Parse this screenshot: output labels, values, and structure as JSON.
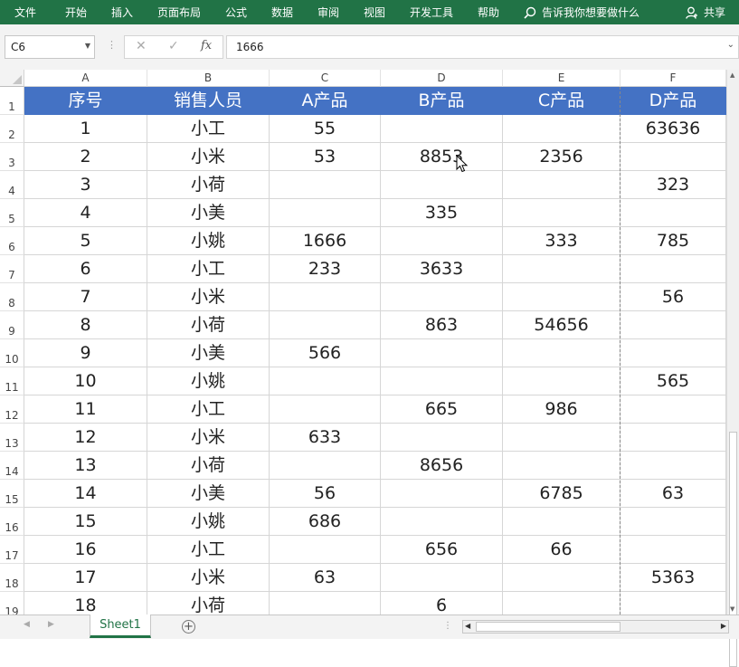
{
  "ribbon": {
    "tabs": [
      "文件",
      "开始",
      "插入",
      "页面布局",
      "公式",
      "数据",
      "审阅",
      "视图",
      "开发工具",
      "帮助"
    ],
    "tell_me": "告诉我你想要做什么",
    "share": "共享"
  },
  "formula_bar": {
    "name_box": "C6",
    "value": "1666",
    "fx_label": "fx"
  },
  "columns": [
    "A",
    "B",
    "C",
    "D",
    "E",
    "F"
  ],
  "table": {
    "header": [
      "序号",
      "销售人员",
      "A产品",
      "B产品",
      "C产品",
      "D产品"
    ],
    "rows": [
      [
        "1",
        "小工",
        "55",
        "",
        "",
        "63636"
      ],
      [
        "2",
        "小米",
        "53",
        "8853",
        "2356",
        ""
      ],
      [
        "3",
        "小荷",
        "",
        "",
        "",
        "323"
      ],
      [
        "4",
        "小美",
        "",
        "335",
        "",
        ""
      ],
      [
        "5",
        "小姚",
        "1666",
        "",
        "333",
        "785"
      ],
      [
        "6",
        "小工",
        "233",
        "3633",
        "",
        ""
      ],
      [
        "7",
        "小米",
        "",
        "",
        "",
        "56"
      ],
      [
        "8",
        "小荷",
        "",
        "863",
        "54656",
        ""
      ],
      [
        "9",
        "小美",
        "566",
        "",
        "",
        ""
      ],
      [
        "10",
        "小姚",
        "",
        "",
        "",
        "565"
      ],
      [
        "11",
        "小工",
        "",
        "665",
        "986",
        ""
      ],
      [
        "12",
        "小米",
        "633",
        "",
        "",
        ""
      ],
      [
        "13",
        "小荷",
        "",
        "8656",
        "",
        ""
      ],
      [
        "14",
        "小美",
        "56",
        "",
        "6785",
        "63"
      ],
      [
        "15",
        "小姚",
        "686",
        "",
        "",
        ""
      ],
      [
        "16",
        "小工",
        "",
        "656",
        "66",
        ""
      ],
      [
        "17",
        "小米",
        "63",
        "",
        "",
        "5363"
      ],
      [
        "18",
        "小荷",
        "",
        "6",
        "",
        ""
      ]
    ]
  },
  "sheets": {
    "active": "Sheet1"
  },
  "colors": {
    "ribbon": "#217346",
    "header_fill": "#4472c4",
    "header_text": "#ffffff"
  }
}
